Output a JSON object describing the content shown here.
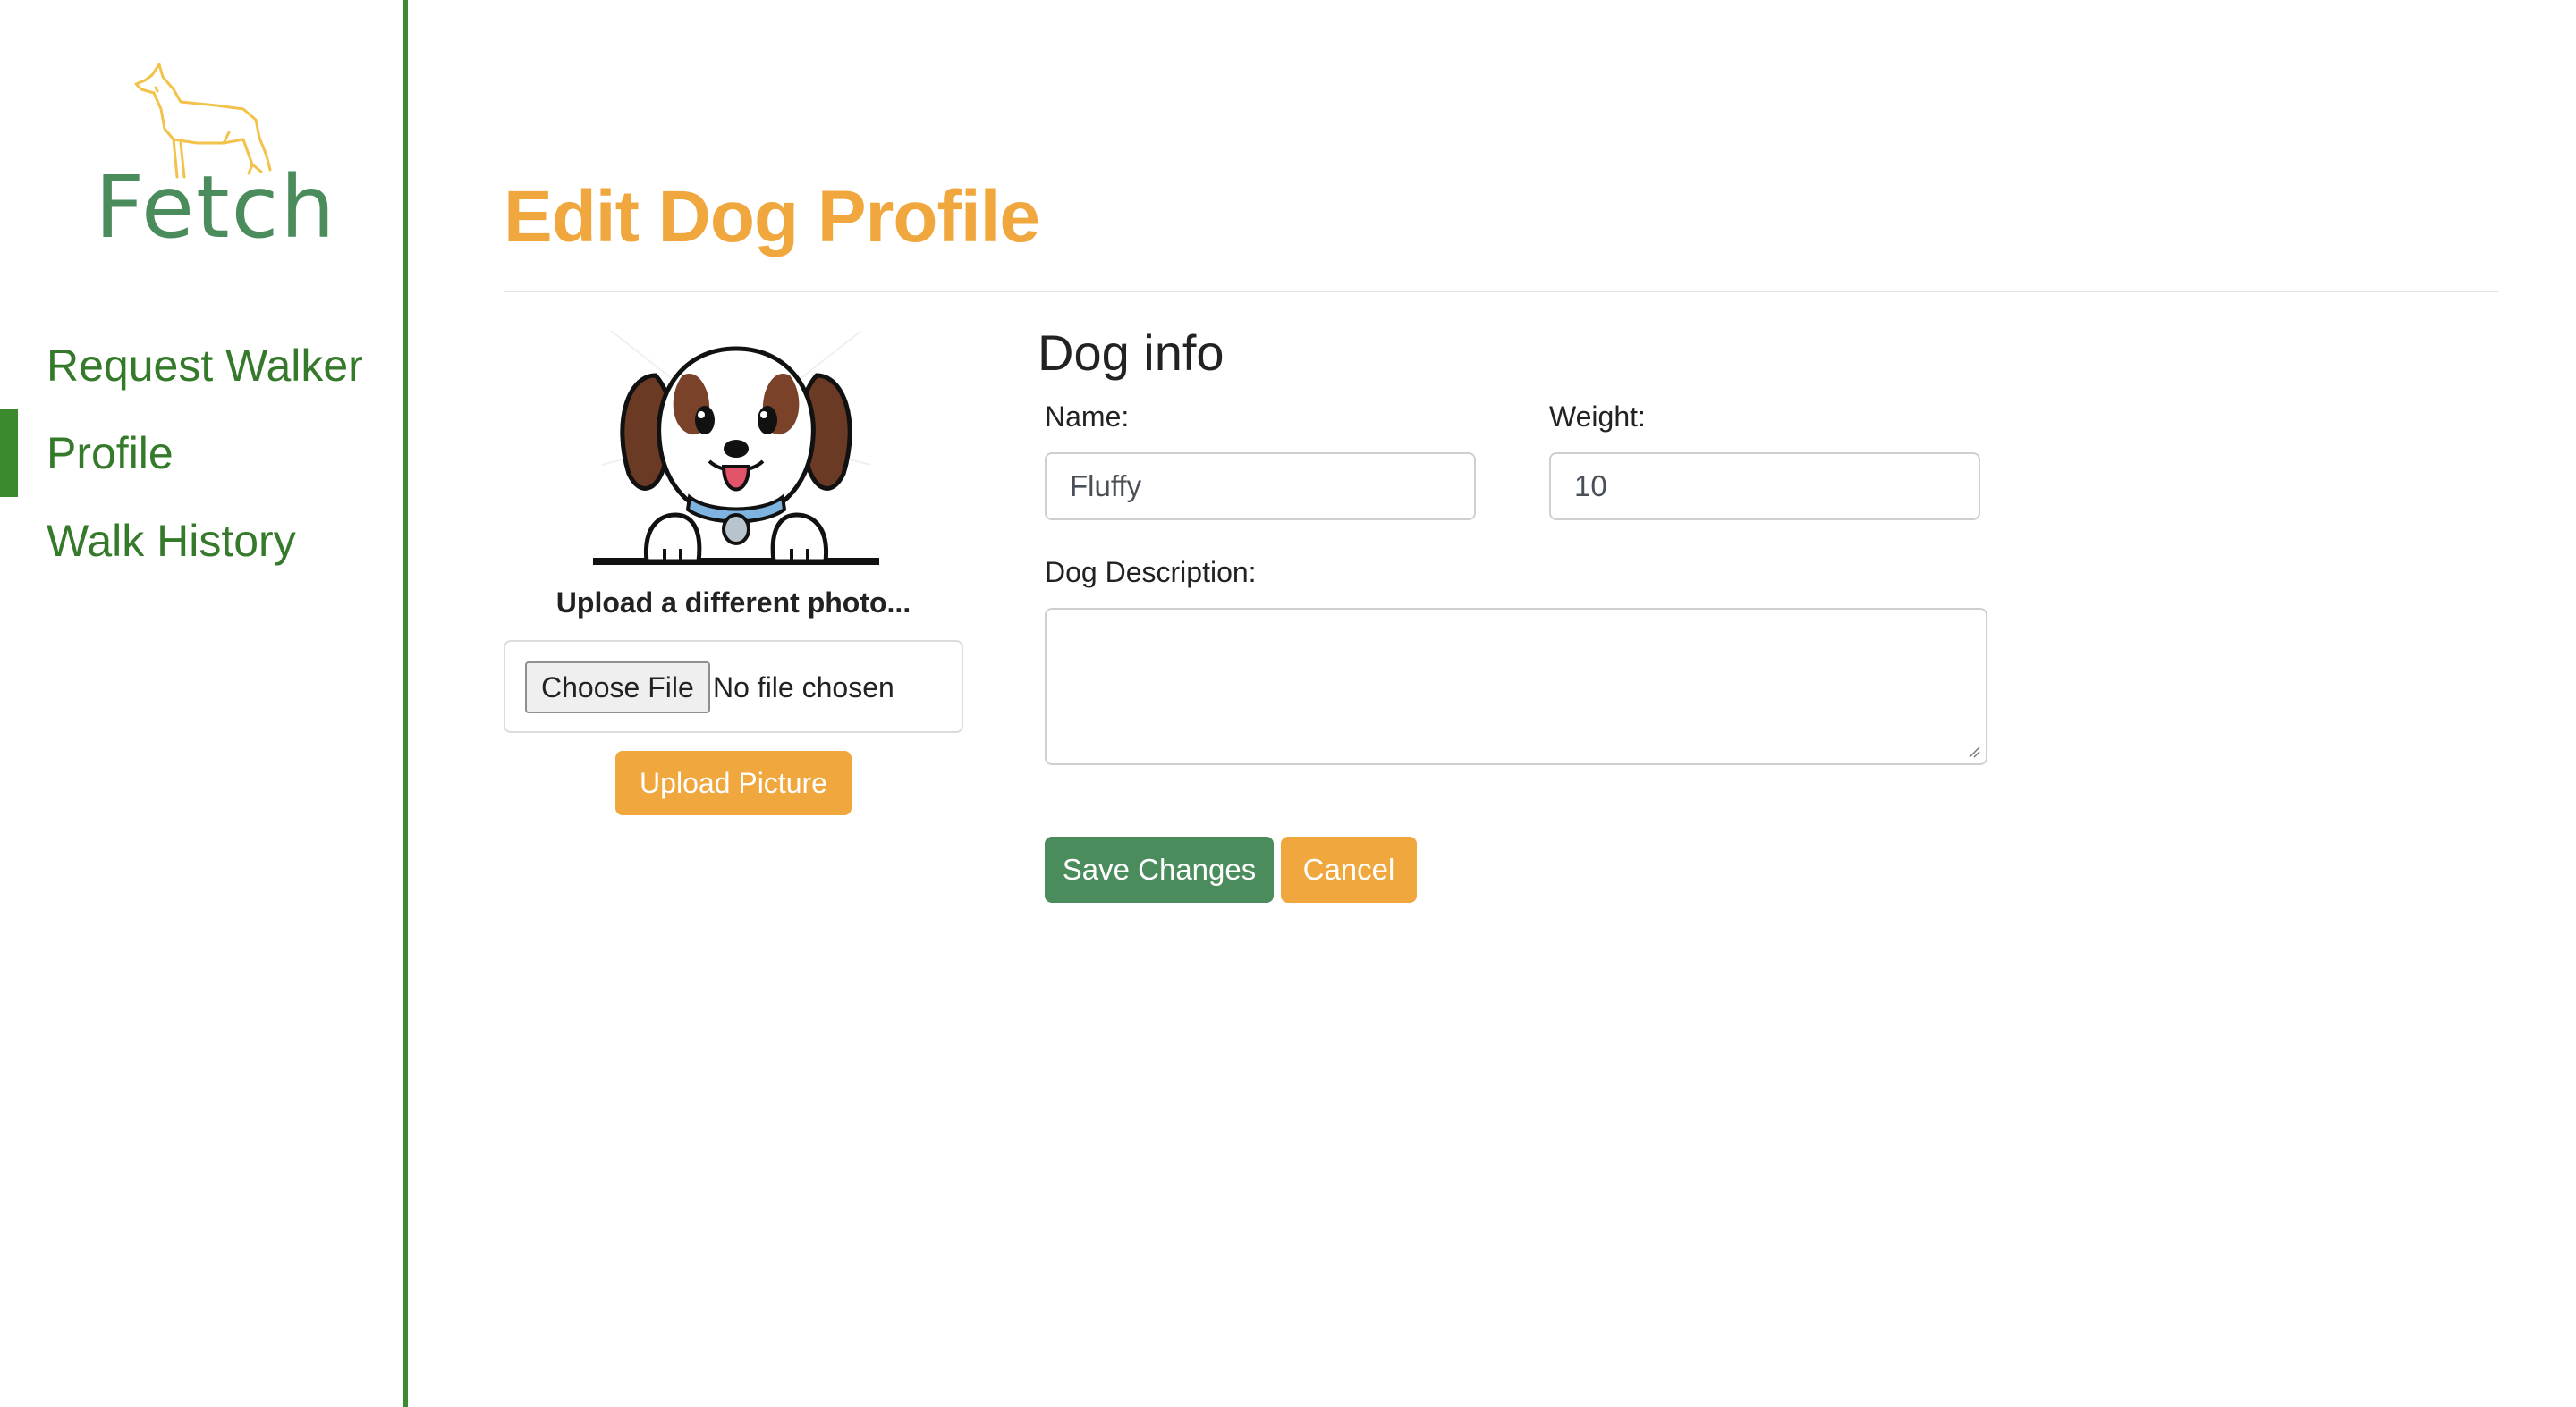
{
  "brand": {
    "name": "Fetch"
  },
  "nav": {
    "items": [
      {
        "label": "Request Walker",
        "active": false
      },
      {
        "label": "Profile",
        "active": true
      },
      {
        "label": "Walk History",
        "active": false
      }
    ]
  },
  "page": {
    "title": "Edit Dog Profile"
  },
  "photo": {
    "caption": "Upload a different photo...",
    "choose_file_label": "Choose File",
    "file_status": "No file chosen",
    "upload_button": "Upload Picture"
  },
  "form": {
    "section_title": "Dog info",
    "name_label": "Name:",
    "name_value": "Fluffy",
    "weight_label": "Weight:",
    "weight_value": "10",
    "description_label": "Dog Description:",
    "description_value": "",
    "save_button": "Save Changes",
    "cancel_button": "Cancel"
  },
  "colors": {
    "accent_orange": "#f0a73e",
    "brand_green": "#3b8a2e",
    "button_green": "#4a8c5c"
  }
}
